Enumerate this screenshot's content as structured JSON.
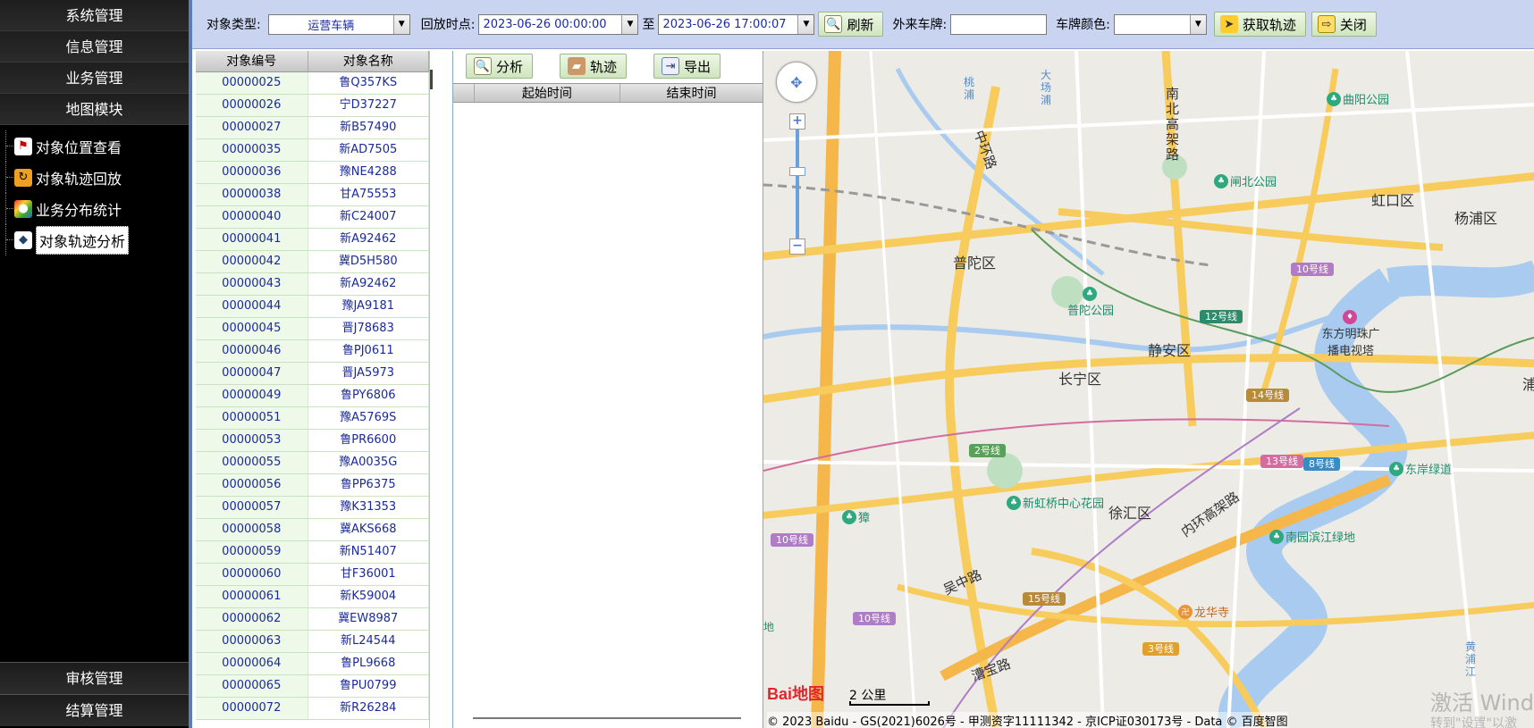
{
  "nav": {
    "top_items": [
      "系统管理",
      "信息管理",
      "业务管理",
      "地图模块"
    ],
    "tree_items": [
      {
        "label": "对象位置查看",
        "icon": "flag-icon"
      },
      {
        "label": "对象轨迹回放",
        "icon": "replay-icon"
      },
      {
        "label": "业务分布统计",
        "icon": "chart-icon"
      },
      {
        "label": "对象轨迹分析",
        "icon": "analysis-icon"
      }
    ],
    "active_index": 3,
    "bottom_items": [
      "审核管理",
      "结算管理"
    ]
  },
  "toolbar": {
    "object_type_label": "对象类型:",
    "object_type_value": "运营车辆",
    "replay_point_label": "回放时点:",
    "start_time": "2023-06-26 00:00:00",
    "to_label": "至",
    "end_time": "2023-06-26 17:00:07",
    "refresh_label": "刷新",
    "foreign_plate_label": "外来车牌:",
    "foreign_plate_value": "",
    "plate_color_label": "车牌颜色:",
    "plate_color_value": "",
    "get_track_label": "获取轨迹",
    "close_label": "关闭"
  },
  "object_list": {
    "headers": [
      "对象编号",
      "对象名称"
    ],
    "rows": [
      [
        "00000025",
        "鲁Q357KS"
      ],
      [
        "00000026",
        "宁D37227"
      ],
      [
        "00000027",
        "新B57490"
      ],
      [
        "00000035",
        "新AD7505"
      ],
      [
        "00000036",
        "豫NE4288"
      ],
      [
        "00000038",
        "甘A75553"
      ],
      [
        "00000040",
        "新C24007"
      ],
      [
        "00000041",
        "新A92462"
      ],
      [
        "00000042",
        "冀D5H580"
      ],
      [
        "00000043",
        "新A92462"
      ],
      [
        "00000044",
        "豫JA9181"
      ],
      [
        "00000045",
        "晋J78683"
      ],
      [
        "00000046",
        "鲁PJ0611"
      ],
      [
        "00000047",
        "晋JA5973"
      ],
      [
        "00000049",
        "鲁PY6806"
      ],
      [
        "00000051",
        "豫A5769S"
      ],
      [
        "00000053",
        "鲁PR6600"
      ],
      [
        "00000055",
        "豫A0035G"
      ],
      [
        "00000056",
        "鲁PP6375"
      ],
      [
        "00000057",
        "豫K31353"
      ],
      [
        "00000058",
        "冀AKS668"
      ],
      [
        "00000059",
        "新N51407"
      ],
      [
        "00000060",
        "甘F36001"
      ],
      [
        "00000061",
        "新K59004"
      ],
      [
        "00000062",
        "冀EW8987"
      ],
      [
        "00000063",
        "新L24544"
      ],
      [
        "00000064",
        "鲁PL9668"
      ],
      [
        "00000065",
        "鲁PU0799"
      ],
      [
        "00000072",
        "新R26284"
      ]
    ]
  },
  "mid_panel": {
    "analyze_label": "分析",
    "track_label": "轨迹",
    "export_label": "导出",
    "col_start": "起始时间",
    "col_end": "结束时间"
  },
  "map": {
    "districts": [
      "普陀区",
      "静安区",
      "长宁区",
      "徐汇区",
      "虹口区",
      "杨浦区",
      "浦"
    ],
    "roads": [
      "中环路",
      "南北高架路",
      "内环高架路",
      "吴中路",
      "漕宝路",
      "大场浦",
      "桃浦",
      "黄浦江"
    ],
    "parks": [
      "曲阳公园",
      "闸北公园",
      "普陀公园",
      "新虹桥中心花园",
      "南园滨江绿地",
      "东岸绿道",
      "龙华寺",
      "东方明珠广播电视塔",
      "獐"
    ],
    "metro_lines": [
      "10号线",
      "12号线",
      "14号线",
      "2号线",
      "13号线",
      "8号线",
      "10号线",
      "15号线",
      "10号线",
      "3号线"
    ],
    "edge_label": "地",
    "scale_label": "2 公里",
    "logo_text": "Bai地图",
    "copyright": "© 2023 Baidu - GS(2021)6026号 - 甲测资字11111342 - 京ICP证030173号 - Data © 百度智图",
    "watermark": "激活 Windo",
    "watermark_sub": "转到\"设置\"以激"
  }
}
